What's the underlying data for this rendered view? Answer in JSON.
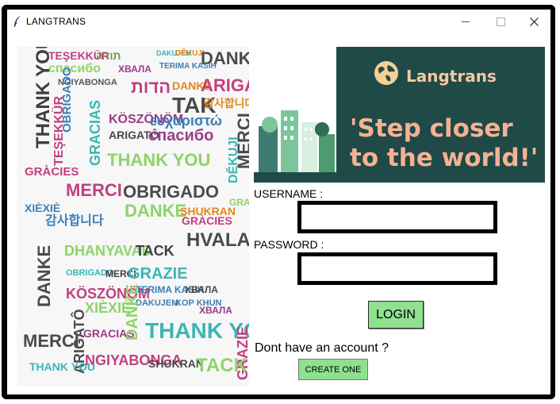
{
  "window": {
    "title": "LANGTRANS"
  },
  "banner": {
    "brand": "Langtrans",
    "tagline": "'Step closer to the world!'",
    "colors": {
      "background": "#1f4a47",
      "text": "#f6b193",
      "globe": "#f3cf95"
    }
  },
  "form": {
    "username_label": "USERNAME :",
    "password_label": "PASSWORD :",
    "username_value": "",
    "password_value": "",
    "login_label": "LOGIN",
    "signup_prompt": "Dont have an account ?",
    "create_label": "CREATE ONE",
    "button_color": "#8fe08f"
  },
  "word_cloud": [
    {
      "text": "TEŞEKKÜR",
      "color": "#c2407f"
    },
    {
      "text": "תודה",
      "color": "#6f9a4a"
    },
    {
      "text": "DAKUJEM",
      "color": "#3ab6b6"
    },
    {
      "text": "DĚKUJI",
      "color": "#e0891e"
    },
    {
      "text": "DANKE",
      "color": "#4a4a4a"
    },
    {
      "text": "спасибо",
      "color": "#8fd36a"
    },
    {
      "text": "ХВАЛА",
      "color": "#9b3c8a"
    },
    {
      "text": "TERIMA KASIH",
      "color": "#3b7fb8"
    },
    {
      "text": "THANK YOU",
      "color": "#3f3f3f"
    },
    {
      "text": "NGIYABONGA",
      "color": "#555555"
    },
    {
      "text": "הדות",
      "color": "#c23f7d"
    },
    {
      "text": "DANKE",
      "color": "#e0891e"
    },
    {
      "text": "ARIGATÔ",
      "color": "#c2407f"
    },
    {
      "text": "OBRIGADO",
      "color": "#3b7fb8"
    },
    {
      "text": "TAK",
      "color": "#4a4a4a"
    },
    {
      "text": "감사합니다",
      "color": "#e0891e"
    },
    {
      "text": "KÖSZÖNÖM",
      "color": "#9b3c8a"
    },
    {
      "text": "ευχαριστώ",
      "color": "#3b7fb8"
    },
    {
      "text": "GRACIAS",
      "color": "#3ab6b6"
    },
    {
      "text": "ARIGATÔ",
      "color": "#4a4a4a"
    },
    {
      "text": "спасибо",
      "color": "#9b3c8a"
    },
    {
      "text": "TEŞEKKÜR",
      "color": "#c2407f"
    },
    {
      "text": "MERCI",
      "color": "#4a4a4a"
    },
    {
      "text": "GRÀCIES",
      "color": "#c2407f"
    },
    {
      "text": "THANK YOU",
      "color": "#8fd36a"
    },
    {
      "text": "DĚKUJI",
      "color": "#3ab6b6"
    },
    {
      "text": "MERCI",
      "color": "#c2407f"
    },
    {
      "text": "OBRIGADO",
      "color": "#4a4a4a"
    },
    {
      "text": "XIÈXIÈ",
      "color": "#3b7fb8"
    },
    {
      "text": "DANKE",
      "color": "#8fd36a"
    },
    {
      "text": "SHUKRAN",
      "color": "#e0891e"
    },
    {
      "text": "GRACIAS",
      "color": "#8fd36a"
    },
    {
      "text": "감사합니다",
      "color": "#3b7fb8"
    },
    {
      "text": "GRÀCIES",
      "color": "#c2407f"
    },
    {
      "text": "DHANYAVAD",
      "color": "#8fd36a"
    },
    {
      "text": "TACK",
      "color": "#3f3f3f"
    },
    {
      "text": "HVALA",
      "color": "#4a4a4a"
    },
    {
      "text": "DANKE",
      "color": "#4a4a4a"
    },
    {
      "text": "OBRIGADO",
      "color": "#3ab6b6"
    },
    {
      "text": "MERCI",
      "color": "#3f3f3f"
    },
    {
      "text": "GRAZIE",
      "color": "#3ab6b6"
    },
    {
      "text": "KÖSZÖNÖM",
      "color": "#c2407f"
    },
    {
      "text": "TERIMA KASIH",
      "color": "#3b7fb8"
    },
    {
      "text": "ХВАЛА",
      "color": "#4a4a4a"
    },
    {
      "text": "XIÈXIÈ",
      "color": "#8fd36a"
    },
    {
      "text": "DAKUJEM",
      "color": "#3b7fb8"
    },
    {
      "text": "ARIGATÔ",
      "color": "#4a4a4a"
    },
    {
      "text": "MERCI",
      "color": "#4a4a4a"
    },
    {
      "text": "GRACIAS",
      "color": "#9b3c8a"
    },
    {
      "text": "DANKE",
      "color": "#8fd36a"
    },
    {
      "text": "THANK YOU",
      "color": "#3ab6b6"
    },
    {
      "text": "GRAZIE",
      "color": "#c2407f"
    },
    {
      "text": "ХВАЛА",
      "color": "#9b3c8a"
    },
    {
      "text": "NGIYABONGA",
      "color": "#c2407f"
    },
    {
      "text": "SHUKRAN",
      "color": "#4a4a4a"
    },
    {
      "text": "TACK",
      "color": "#8fd36a"
    },
    {
      "text": "KOP KHUN",
      "color": "#3b7fb8"
    },
    {
      "text": "THANK YOU",
      "color": "#3ab6b6"
    }
  ]
}
